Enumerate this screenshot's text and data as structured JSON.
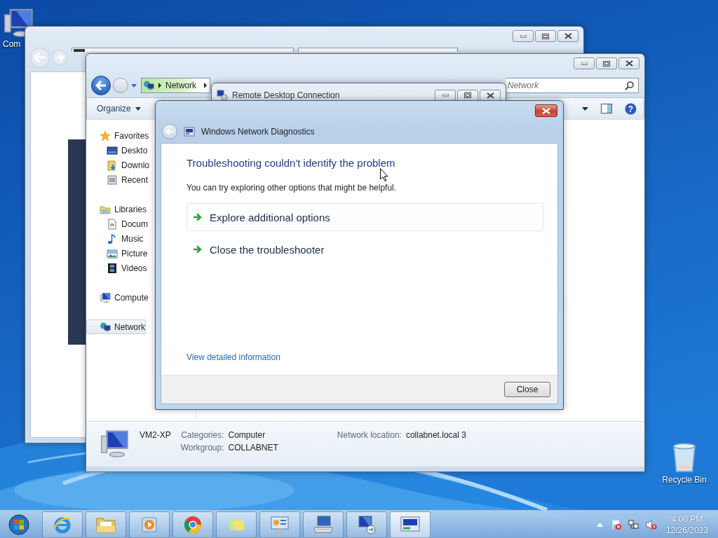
{
  "desktop_icons": [
    {
      "label": "Com",
      "kind": "computer"
    },
    {
      "label": "Recycle Bin",
      "kind": "recycle"
    }
  ],
  "explorer": {
    "breadcrumb": "Network",
    "search": {
      "placeholder": "Network"
    },
    "toolbar": {
      "organize": "Organize",
      "help": "?"
    },
    "sidebar": [
      {
        "label": "Favorites",
        "kind": "star",
        "selected": false,
        "children": [
          {
            "label": "Deskto",
            "kind": "desktop",
            "selected": false
          },
          {
            "label": "Downlo",
            "kind": "download",
            "selected": false
          },
          {
            "label": "Recent",
            "kind": "recent",
            "selected": false
          }
        ]
      },
      {
        "label": "Libraries",
        "kind": "library",
        "selected": false,
        "children": [
          {
            "label": "Docum",
            "kind": "document",
            "selected": false
          },
          {
            "label": "Music",
            "kind": "music",
            "selected": false
          },
          {
            "label": "Picture",
            "kind": "pictures",
            "selected": false
          },
          {
            "label": "Videos",
            "kind": "videos",
            "selected": false
          }
        ]
      },
      {
        "label": "Compute",
        "kind": "computer",
        "selected": false
      },
      {
        "label": "Network",
        "kind": "network",
        "selected": true
      }
    ],
    "details": {
      "name": "VM2-XP",
      "columns": [
        [
          {
            "label": "Categories:",
            "value": "Computer"
          },
          {
            "label": "Workgroup:",
            "value": "COLLABNET"
          }
        ],
        [
          {
            "label": "Network location:",
            "value": "collabnet.local 3"
          }
        ]
      ]
    }
  },
  "rdc_window": {
    "title": "Remote Desktop Connection"
  },
  "dialog": {
    "title": "Windows Network Diagnostics",
    "heading": "Troubleshooting couldn't identify the problem",
    "message": "You can try exploring other options that might be helpful.",
    "options": [
      {
        "label": "Explore additional options",
        "highlighted": true
      },
      {
        "label": "Close the troubleshooter",
        "highlighted": false
      }
    ],
    "link": "View detailed information",
    "button": "Close"
  },
  "taskbar": {
    "clock": {
      "time": "4:00 PM",
      "date": "12/26/2023"
    }
  }
}
